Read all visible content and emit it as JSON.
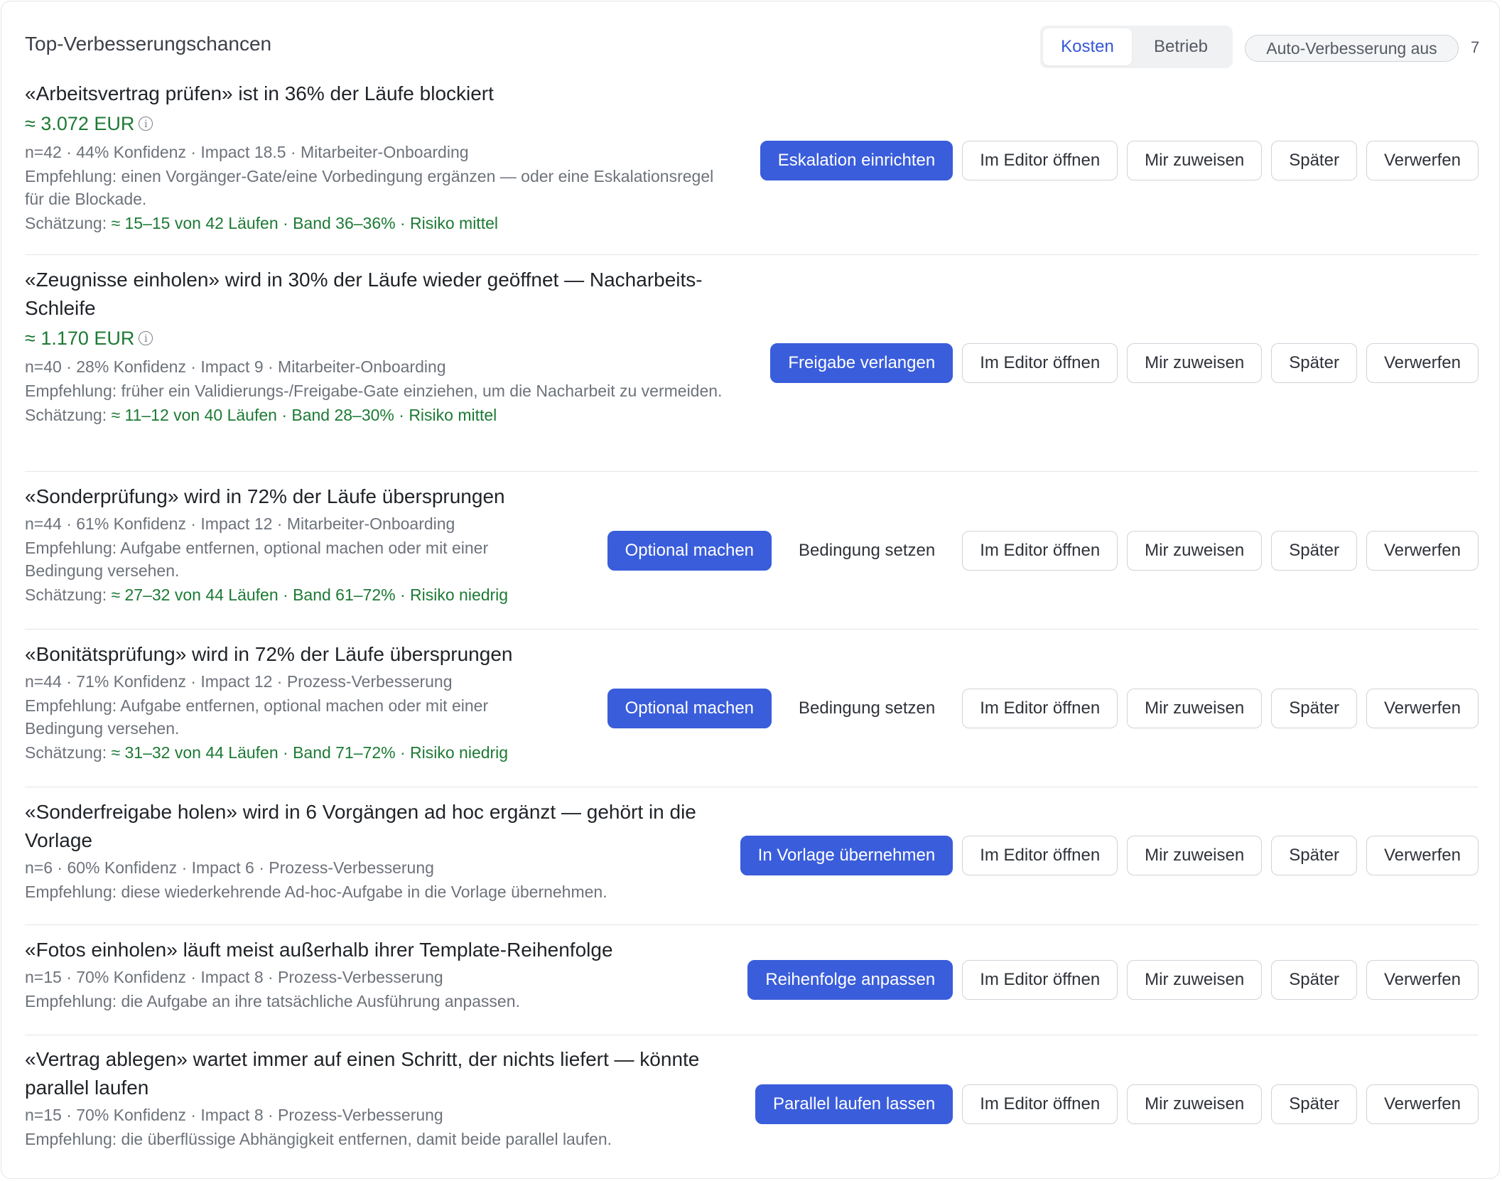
{
  "header": {
    "title": "Top-Verbesserungschancen",
    "tabs": [
      {
        "label": "Kosten",
        "active": true
      },
      {
        "label": "Betrieb",
        "active": false
      }
    ],
    "auto_pill": "Auto-Verbesserung aus",
    "count": "7"
  },
  "common_buttons": {
    "condition": "Bedingung setzen",
    "editor": "Im Editor öffnen",
    "assign": "Mir zuweisen",
    "later": "Später",
    "dismiss": "Verwerfen"
  },
  "items": [
    {
      "title": "«Arbeitsvertrag prüfen» ist in 36% der Läufe blockiert",
      "money": "≈ 3.072 EUR",
      "meta": "n=42 · 44% Konfidenz · Impact 18.5 · Mitarbeiter-Onboarding",
      "rec": "Empfehlung: einen Vorgänger-Gate/eine Vorbedingung ergänzen — oder eine Eskalationsregel für die Blockade.",
      "est_label": "Schätzung:",
      "est_value": "≈ 15–15 von 42 Läufen · Band 36–36% · Risiko mittel",
      "primary": "Eskalation einrichten"
    },
    {
      "title": "«Zeugnisse einholen» wird in 30% der Läufe wieder geöffnet — Nacharbeits-Schleife",
      "money": "≈ 1.170 EUR",
      "meta": "n=40 · 28% Konfidenz · Impact 9 · Mitarbeiter-Onboarding",
      "rec": "Empfehlung: früher ein Validierungs-/Freigabe-Gate einziehen, um die Nacharbeit zu vermeiden.",
      "est_label": "Schätzung:",
      "est_value": "≈ 11–12 von 40 Läufen · Band 28–30% · Risiko mittel",
      "primary": "Freigabe verlangen"
    },
    {
      "title": "«Sonderprüfung» wird in 72% der Läufe übersprungen",
      "meta": "n=44 · 61% Konfidenz · Impact 12 · Mitarbeiter-Onboarding",
      "rec": "Empfehlung: Aufgabe entfernen, optional machen oder mit einer Bedingung versehen.",
      "est_label": "Schätzung:",
      "est_value": "≈ 27–32 von 44 Läufen · Band 61–72% · Risiko niedrig",
      "primary": "Optional machen"
    },
    {
      "title": "«Bonitätsprüfung» wird in 72% der Läufe übersprungen",
      "meta": "n=44 · 71% Konfidenz · Impact 12 · Prozess-Verbesserung",
      "rec": "Empfehlung: Aufgabe entfernen, optional machen oder mit einer Bedingung versehen.",
      "est_label": "Schätzung:",
      "est_value": "≈ 31–32 von 44 Läufen · Band 71–72% · Risiko niedrig",
      "primary": "Optional machen"
    },
    {
      "title": "«Sonderfreigabe holen» wird in 6 Vorgängen ad hoc ergänzt — gehört in die Vorlage",
      "meta": "n=6 · 60% Konfidenz · Impact 6 · Prozess-Verbesserung",
      "rec": "Empfehlung: diese wiederkehrende Ad-hoc-Aufgabe in die Vorlage übernehmen.",
      "primary": "In Vorlage übernehmen"
    },
    {
      "title": "«Fotos einholen» läuft meist außerhalb ihrer Template-Reihenfolge",
      "meta": "n=15 · 70% Konfidenz · Impact 8 · Prozess-Verbesserung",
      "rec": "Empfehlung: die Aufgabe an ihre tatsächliche Ausführung anpassen.",
      "primary": "Reihenfolge anpassen"
    },
    {
      "title": "«Vertrag ablegen» wartet immer auf einen Schritt, der nichts liefert — könnte parallel laufen",
      "meta": "n=15 · 70% Konfidenz · Impact 8 · Prozess-Verbesserung",
      "rec": "Empfehlung: die überflüssige Abhängigkeit entfernen, damit beide parallel laufen.",
      "primary": "Parallel laufen lassen"
    }
  ]
}
